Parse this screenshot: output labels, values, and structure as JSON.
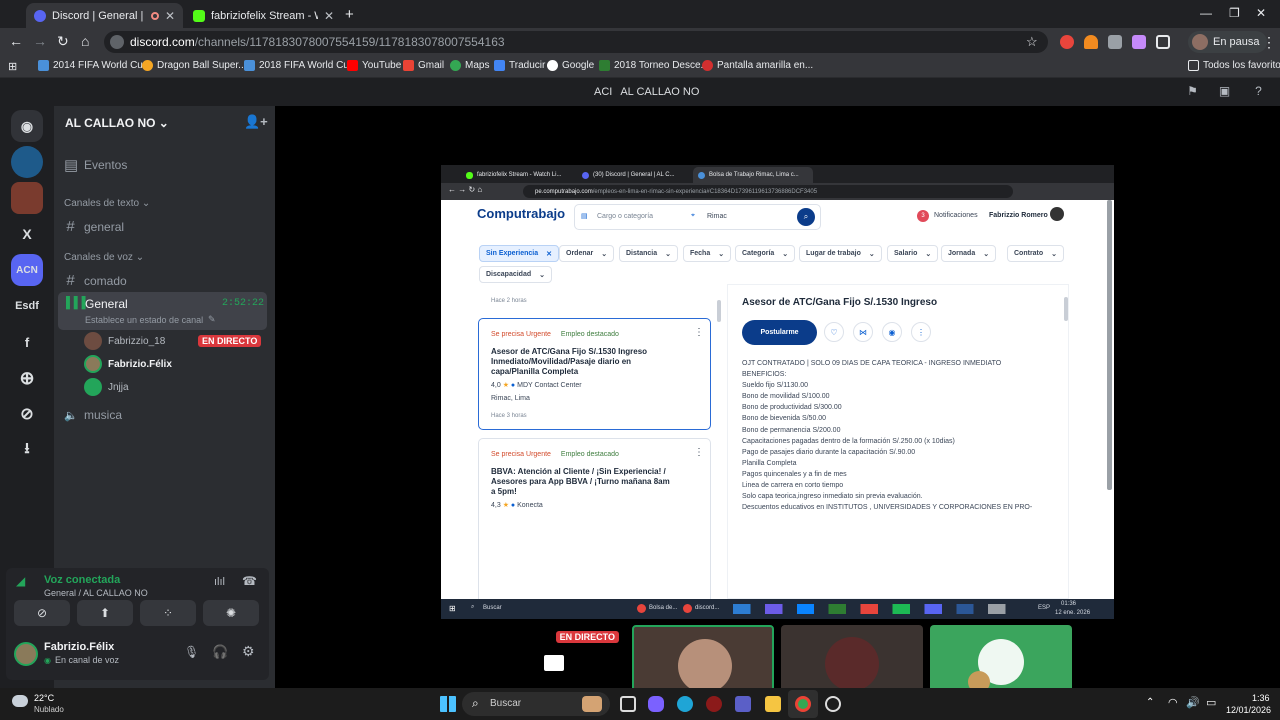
{
  "browser": {
    "tabs": [
      {
        "title": "Discord | General | AL CALLAO NO",
        "favicon_color": "#5865f2"
      },
      {
        "title": "fabriziofelix Stream - Watch Live",
        "favicon_color": "#53fc18"
      }
    ],
    "url_host": "discord.com",
    "url_path": "/channels/1178183078007554159/1178183078007554163",
    "profile_status": "En pausa",
    "bookmarks": [
      "2014 FIFA World Cu...",
      "Dragon Ball Super...",
      "2018 FIFA World Cu...",
      "YouTube",
      "Gmail",
      "Maps",
      "Traducir",
      "Google",
      "2018 Torneo Desce...",
      "Pantalla amarilla en..."
    ],
    "all_favorites": "Todos los favoritos"
  },
  "discord": {
    "title_prefix": "ACI",
    "title": "AL CALLAO NO",
    "server_name": "AL CALLAO NO",
    "server_icons": [
      "X",
      "ACN",
      "Esdf",
      "f"
    ],
    "events_label": "Eventos",
    "text_category": "Canales de texto",
    "text_channels": [
      "general"
    ],
    "voice_category": "Canales de voz",
    "voice_channels": [
      "comado",
      "General",
      "musica"
    ],
    "active_voice": {
      "name": "General",
      "timer": "2:52:22",
      "status": "Establece un estado de canal",
      "users": [
        {
          "name": "Fabrizzio_18",
          "live": true
        },
        {
          "name": "Fabrizio.Félix",
          "live": false
        },
        {
          "name": "Jnjja",
          "live": false
        }
      ]
    },
    "live_label": "EN DIRECTO",
    "voice_connected": "Voz conectada",
    "voice_location": "General / AL CALLAO NO",
    "user": {
      "name": "Fabrizio.Félix",
      "status": "En canal de voz"
    },
    "tiles_live_label": "EN DIRECTO"
  },
  "stream": {
    "tabs": [
      "fabriziofelix Stream - Watch Li...",
      "(30) Discord | General | AL C...",
      "Bolsa de Trabajo Rimac, Lima c..."
    ],
    "url_host": "pe.computrabajo.com",
    "url_path": "/empleos-en-lima-en-rimac-sin-experiencia#C18364D17396119613736886DCF3405",
    "site": {
      "logo": "Computrabajo",
      "search_placeholder": "Cargo o categoría",
      "location": "Rimac",
      "notifications_count": "3",
      "notifications_label": "Notificaciones",
      "user": "Fabrizzio Romero",
      "filters": [
        "Sin Experiencia",
        "Ordenar",
        "Distancia",
        "Fecha",
        "Categoría",
        "Lugar de trabajo",
        "Salario",
        "Jornada",
        "Contrato",
        "Discapacidad"
      ],
      "prev_age": "Hace 2 horas",
      "jobs": [
        {
          "urgent": "Se precisa Urgente",
          "featured": "Empleo destacado",
          "title": "Asesor de ATC/Gana Fijo S/.1530 Ingreso Inmediato/Movilidad/Pasaje diario en capa/Planilla Completa",
          "rating": "4,0",
          "company": "MDY Contact Center",
          "location": "Rimac, Lima",
          "age": "Hace 3 horas"
        },
        {
          "urgent": "Se precisa Urgente",
          "featured": "Empleo destacado",
          "title": "BBVA: Atención al Cliente / ¡Sin Experiencia! / Asesores para App BBVA / ¡Turno mañana 8am a 5pm!",
          "rating": "4,3",
          "company": "Konecta"
        }
      ],
      "detail": {
        "title": "Asesor de ATC/Gana Fijo S/.1530 Ingreso",
        "apply": "Postularme",
        "description": [
          "OJT CONTRATADO | SOLO 09 DIAS DE CAPA TEORICA - INGRESO INMEDIATO",
          "BENEFICIOS:",
          "Sueldo fijo S/1130.00",
          "Bono de movilidad S/100.00",
          "Bono de productividad S/300.00",
          "Bono de bievenida S/50.00",
          "Bono de permanencia S/200.00",
          "Capacitaciones pagadas dentro de la formación S/.250.00 (x 10dias)",
          "Pago de pasajes diario durante la capacitación S/.90.00",
          "Planilla Completa",
          "Pagos quincenales y a fin de mes",
          "Linea de carrera en corto tiempo",
          "Solo capa teorica,ingreso inmediato sin previa evaluación.",
          "Descuentos educativos en INSTITUTOS , UNIVERSIDADES Y CORPORACIONES EN PRO-"
        ]
      }
    },
    "taskbar": {
      "search": "Buscar",
      "app1": "Bolsa de...",
      "app2": "discord...",
      "lang": "ESP",
      "time": "01:36",
      "date": "12 ene. 2026"
    }
  },
  "windows": {
    "weather_temp": "22°C",
    "weather_desc": "Nublado",
    "search": "Buscar",
    "time": "1:36",
    "date": "12/01/2026"
  }
}
